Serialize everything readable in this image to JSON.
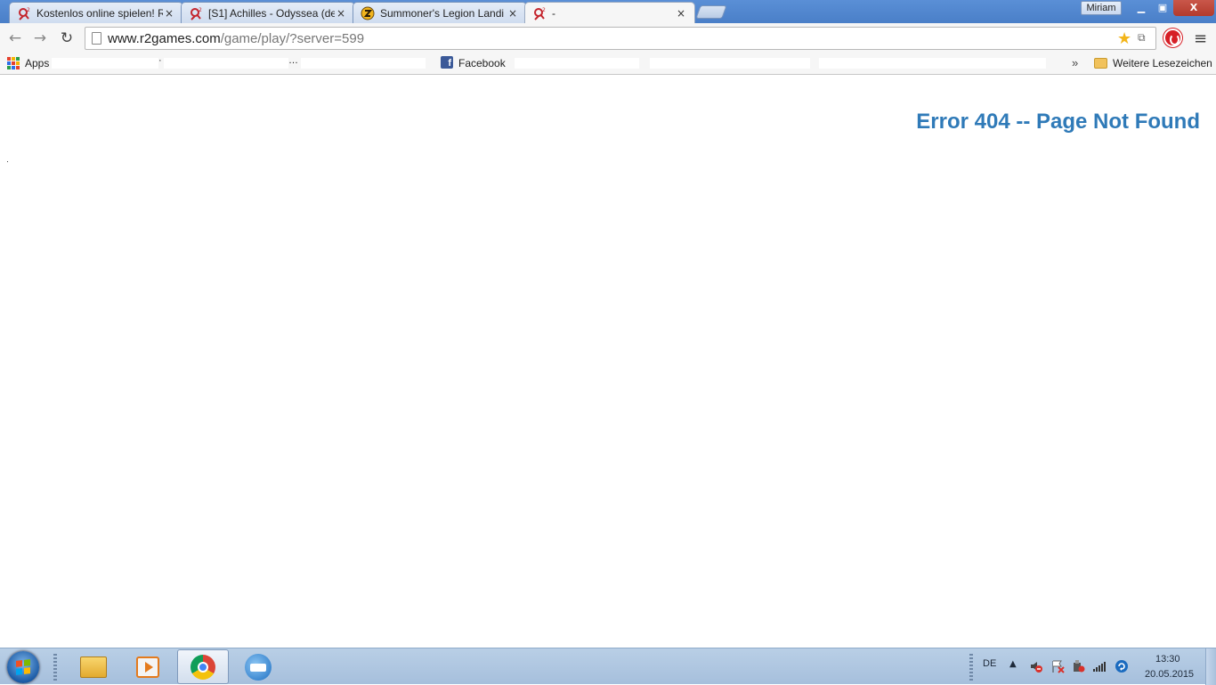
{
  "tabs": [
    {
      "title": "Kostenlos online spielen! R",
      "icon": "r2games-icon",
      "active": false
    },
    {
      "title": "[S1] Achilles - Odyssea (de",
      "icon": "r2games-icon",
      "active": false
    },
    {
      "title": "Summoner's Legion Landi",
      "icon": "summoners-legion-icon",
      "active": false
    },
    {
      "title": "-",
      "icon": "r2games-icon",
      "active": true
    }
  ],
  "tab_close": "×",
  "window": {
    "user": "Miriam",
    "minimize": "▁",
    "maximize": "▣",
    "close": "X"
  },
  "toolbar": {
    "back": "←",
    "forward": "→",
    "reload": "↻",
    "url_host": "www.r2games.com",
    "url_path": "/game/play/?server=599",
    "star": "★",
    "translate": "⧉",
    "menu": "≡"
  },
  "bookmarks": {
    "apps": "Apps",
    "facebook": "Facebook",
    "more": "»",
    "other": "Weitere Lesezeichen",
    "dots": [
      "·",
      "…"
    ]
  },
  "page": {
    "error_title": "Error 404 -- Page Not Found"
  },
  "taskbar": {
    "language": "DE",
    "tray_arrow": "▲",
    "time": "13:30",
    "date": "20.05.2015"
  },
  "colors": {
    "error_text": "#2f7ab8",
    "taskbar": "#a6bfdc",
    "accent_star": "#f3b51a"
  }
}
